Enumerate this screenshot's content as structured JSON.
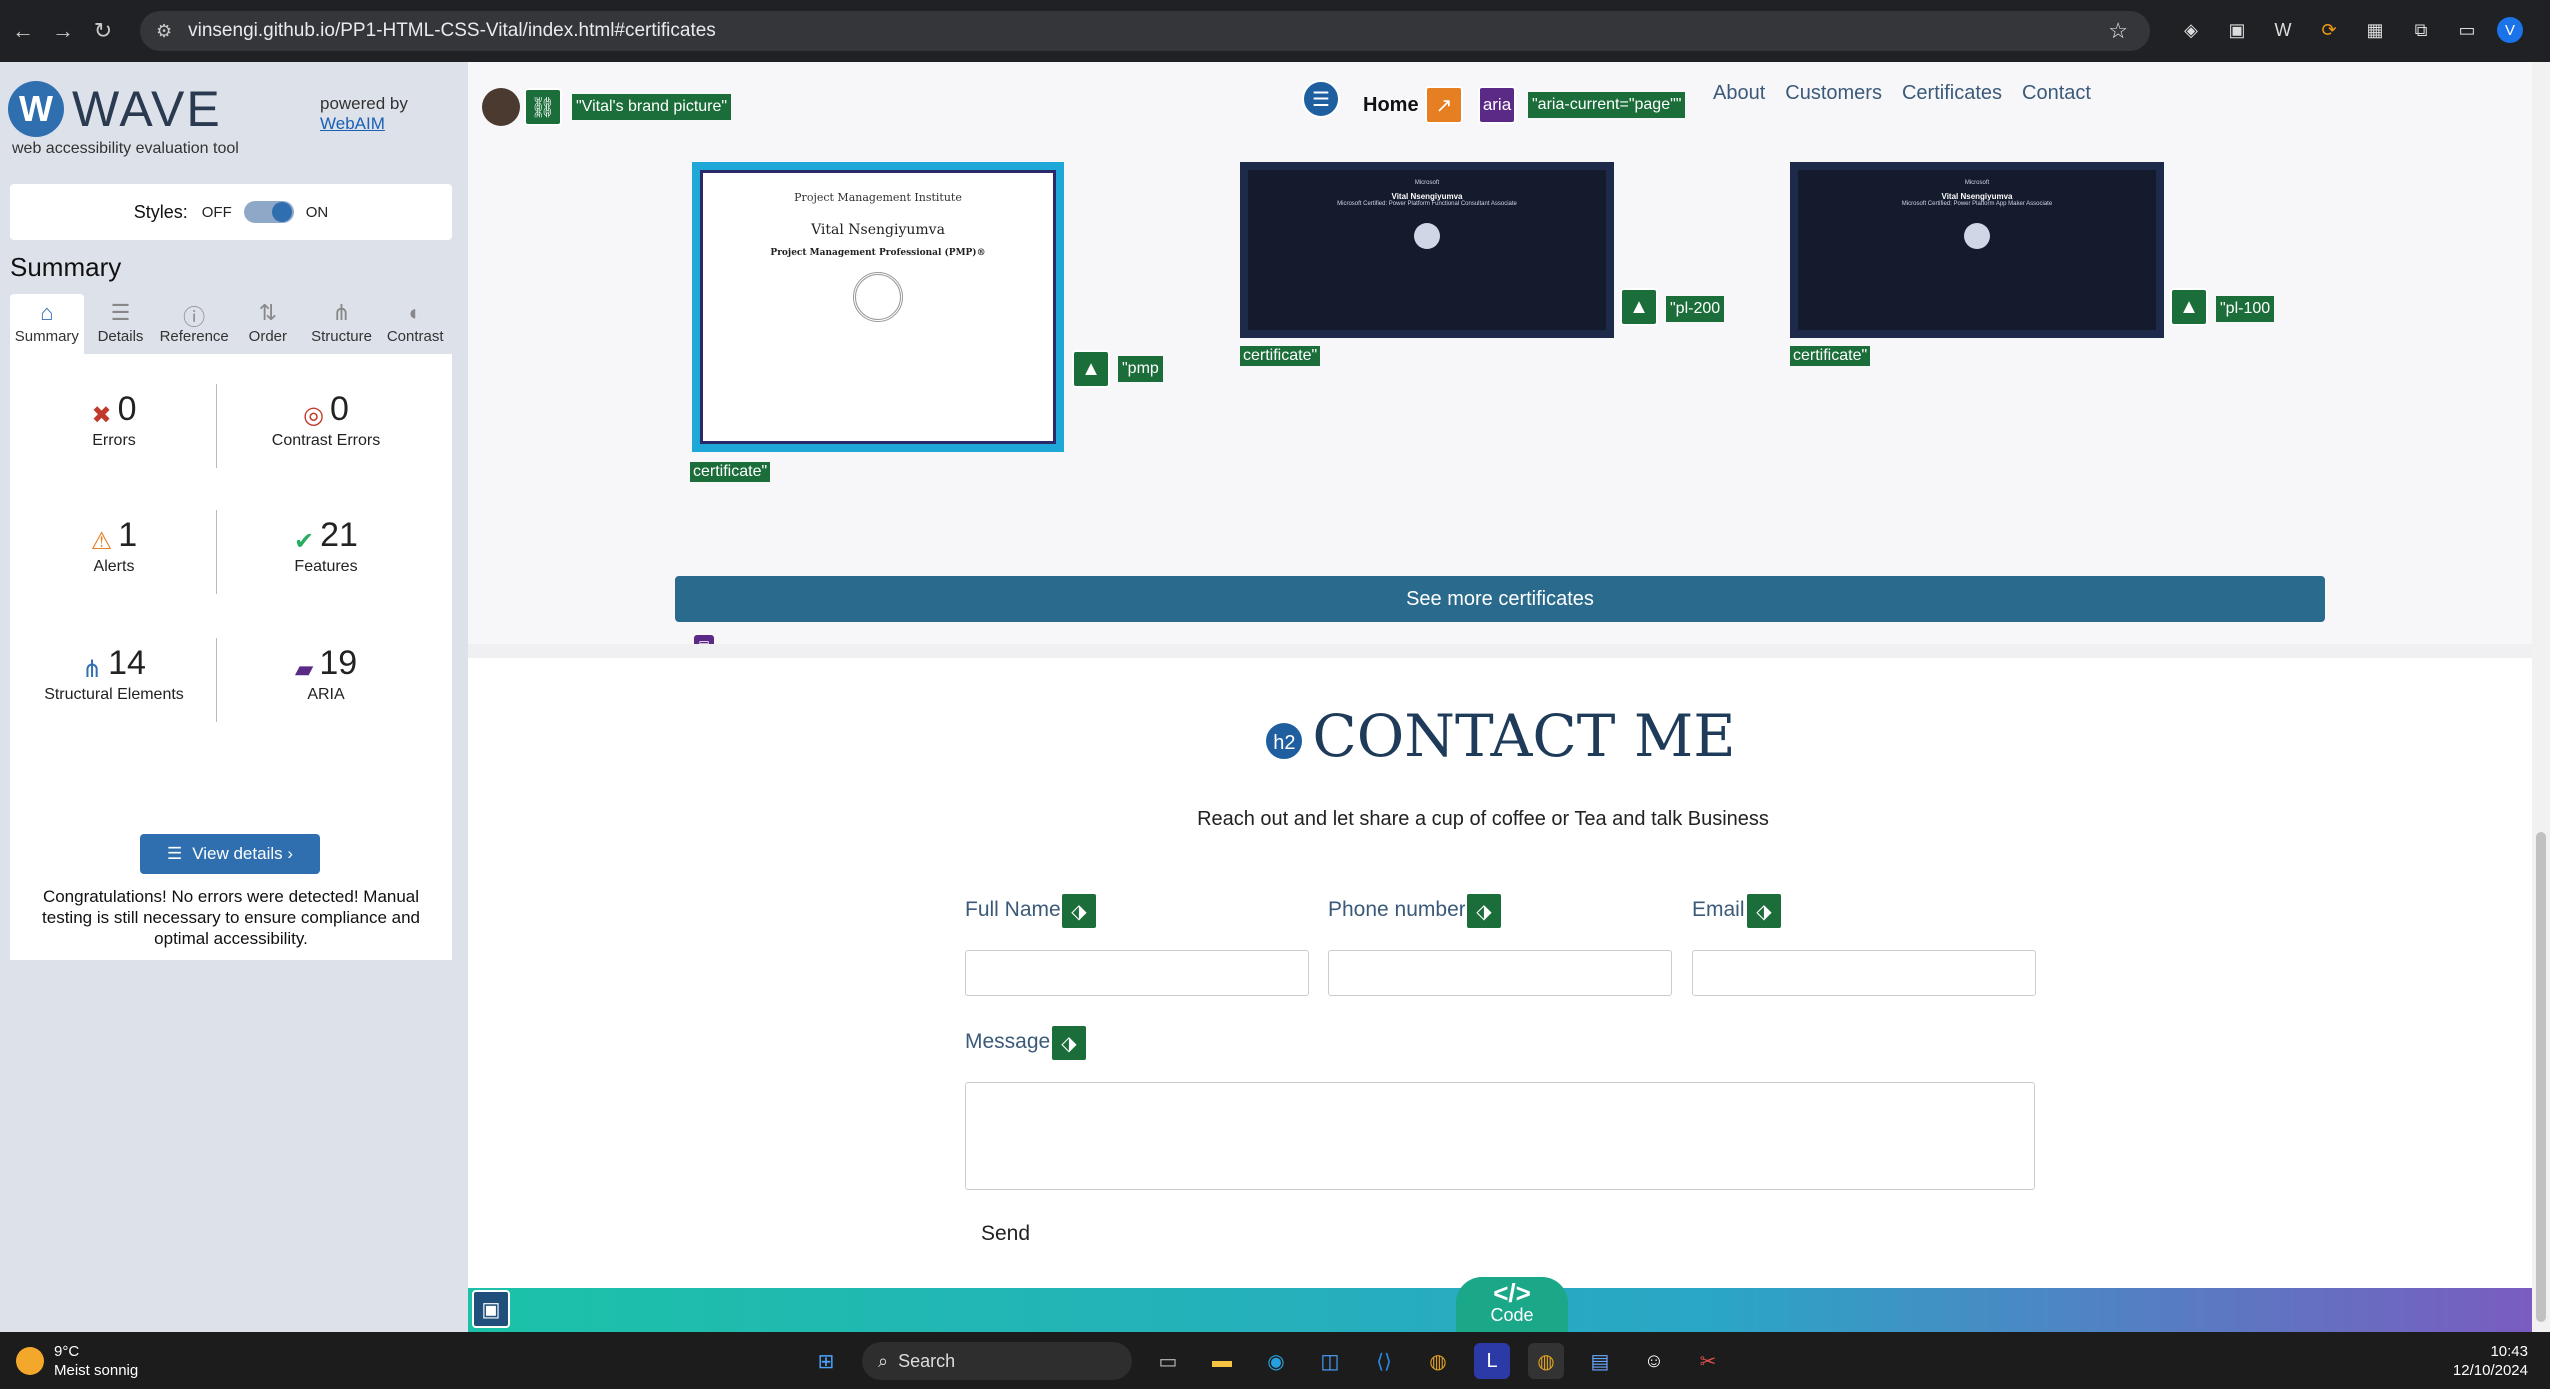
{
  "browser": {
    "url": "vinsengi.github.io/PP1-HTML-CSS-Vital/index.html#certificates",
    "profile_initial": "V"
  },
  "wave": {
    "brand": "WAVE",
    "tagline": "web accessibility evaluation tool",
    "powered_by": "powered by",
    "webaim": "WebAIM",
    "styles_label": "Styles:",
    "styles_off": "OFF",
    "styles_on": "ON",
    "summary_title": "Summary",
    "tabs": [
      "Summary",
      "Details",
      "Reference",
      "Order",
      "Structure",
      "Contrast"
    ],
    "stats": {
      "errors": {
        "value": "0",
        "label": "Errors"
      },
      "contrast": {
        "value": "0",
        "label": "Contrast Errors"
      },
      "alerts": {
        "value": "1",
        "label": "Alerts"
      },
      "features": {
        "value": "21",
        "label": "Features"
      },
      "structural": {
        "value": "14",
        "label": "Structural Elements"
      },
      "aria": {
        "value": "19",
        "label": "ARIA"
      }
    },
    "view_details": "View details ›",
    "congrats": "Congratulations! No errors were detected! Manual testing is still necessary to ensure compliance and optimal accessibility."
  },
  "page": {
    "brand_alt_badge": "\"Vital's brand picture\"",
    "nav": {
      "home": "Home",
      "aria_badge": "aria",
      "aria_current": "\"aria-current=\"page\"\"",
      "links": [
        "About",
        "Customers",
        "Certificates",
        "Contact"
      ]
    },
    "certificates": [
      {
        "alt_start": "\"pmp",
        "alt_end": "certificate\"",
        "pmi": "Project Management Institute",
        "name": "Vital Nsengiyumva",
        "title": "Project Management Professional (PMP)®"
      },
      {
        "alt_start": "\"pl-200",
        "alt_end": "certificate\"",
        "issuer": "Microsoft",
        "name": "Vital Nsengiyumva",
        "title": "Microsoft Certified: Power Platform Functional Consultant Associate"
      },
      {
        "alt_start": "\"pl-100",
        "alt_end": "certificate\"",
        "issuer": "Microsoft",
        "name": "Vital Nsengiyumva",
        "title": "Microsoft Certified: Power Platform App Maker Associate"
      }
    ],
    "see_more": "See more certificates",
    "contact": {
      "h2_badge": "h2",
      "title": "CONTACT ME",
      "subtitle": "Reach out and let share a cup of coffee or Tea and talk Business",
      "fields": [
        "Full Name",
        "Phone number",
        "Email"
      ],
      "message_label": "Message",
      "send": "Send"
    },
    "code_button": "Code",
    "code_symbol": "</>"
  },
  "taskbar": {
    "temp": "9°C",
    "weather": "Meist sonnig",
    "search": "Search",
    "time": "10:43",
    "date": "12/10/2024"
  }
}
